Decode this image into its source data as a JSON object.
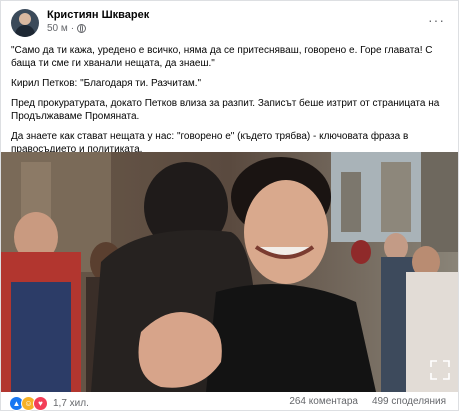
{
  "post": {
    "author": "Кристиян Шкварек",
    "time": "50 м",
    "paragraphs": [
      "\"Само да ти кажа, уредено е всичко, няма да се притесняваш, говорено е. Горе главата! С баща ти сме ги хванали нещата, да знаеш.\"",
      "Кирил Петков: \"Благодаря ти. Разчитам.\"",
      "Пред прокуратурата, докато Петков влиза за разпит. Записът беше изтрит от страницата на Продължаваме Промяната.",
      "Да знаете как стават нещата у нас: \"говорено е\" (където трябва) - ключовата фраза в правосъдието и политиката."
    ],
    "more_label": "···"
  },
  "footer": {
    "reaction_count": "1,7 хил.",
    "comments": "264 коментара",
    "shares": "499 споделяния"
  },
  "icons": {
    "avatar": "profile-photo",
    "privacy": "globe-icon",
    "like": "like-icon",
    "haha": "haha-icon",
    "love": "love-icon",
    "fullscreen": "expand-icon"
  },
  "colors": {
    "text": "#050505",
    "secondary": "#65676b",
    "like": "#1877f2",
    "haha": "#f7b125",
    "love": "#f33e58"
  }
}
